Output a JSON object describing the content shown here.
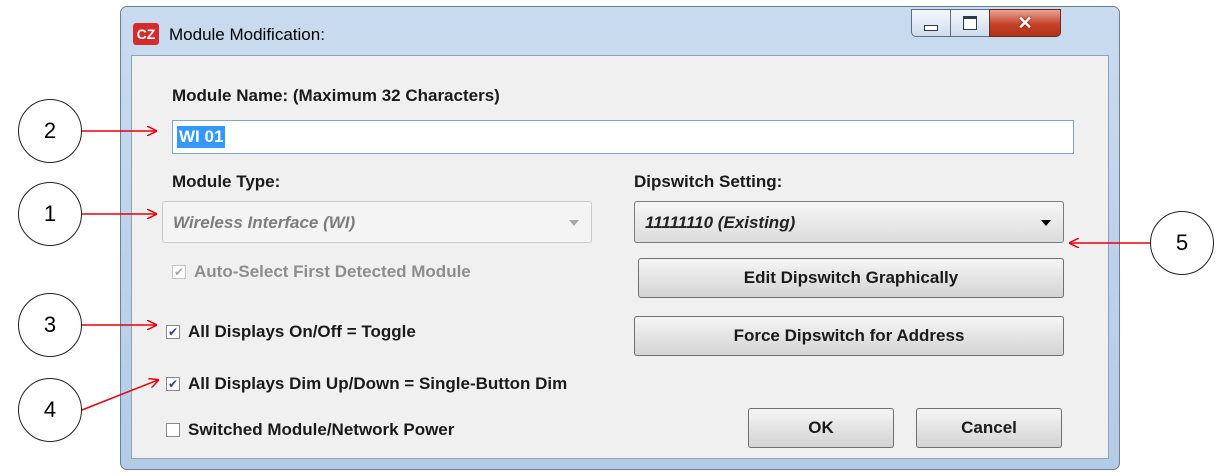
{
  "window": {
    "title": "Module Modification:",
    "icon": "cz-app-icon",
    "controls": {
      "minimize": "minimize-icon",
      "maximize": "maximize-icon",
      "close": "close-icon"
    }
  },
  "form": {
    "module_name_label": "Module Name: (Maximum 32 Characters)",
    "module_name_value": "WI 01",
    "module_type_label": "Module Type:",
    "module_type_value": "Wireless Interface (WI)",
    "dipswitch_label": "Dipswitch Setting:",
    "dipswitch_value": "11111110 (Existing)",
    "auto_select_label": "Auto-Select First Detected Module",
    "toggle_label": "All Displays On/Off = Toggle",
    "dim_label": "All Displays Dim Up/Down = Single-Button Dim",
    "power_label": "Switched Module/Network Power"
  },
  "checkboxes": {
    "auto_select": {
      "checked": true,
      "enabled": false
    },
    "toggle": {
      "checked": true,
      "enabled": true
    },
    "dim": {
      "checked": true,
      "enabled": true
    },
    "power": {
      "checked": false,
      "enabled": true
    }
  },
  "buttons": {
    "edit_dipswitch": "Edit Dipswitch Graphically",
    "force_dipswitch": "Force Dipswitch for Address",
    "ok": "OK",
    "cancel": "Cancel"
  },
  "callouts": [
    "2",
    "1",
    "5",
    "3",
    "4"
  ],
  "colors": {
    "arrow": "#e8000b",
    "selection": "#3399ff",
    "close_button": "#c4432a"
  }
}
